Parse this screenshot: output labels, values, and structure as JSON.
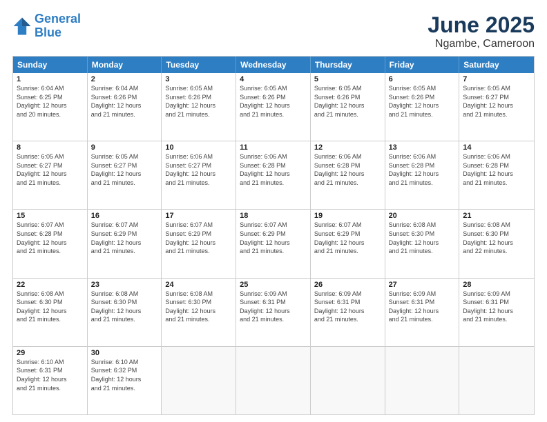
{
  "logo": {
    "line1": "General",
    "line2": "Blue"
  },
  "title": "June 2025",
  "subtitle": "Ngambe, Cameroon",
  "header_days": [
    "Sunday",
    "Monday",
    "Tuesday",
    "Wednesday",
    "Thursday",
    "Friday",
    "Saturday"
  ],
  "weeks": [
    [
      {
        "day": "1",
        "info": "Sunrise: 6:04 AM\nSunset: 6:25 PM\nDaylight: 12 hours\nand 20 minutes."
      },
      {
        "day": "2",
        "info": "Sunrise: 6:04 AM\nSunset: 6:26 PM\nDaylight: 12 hours\nand 21 minutes."
      },
      {
        "day": "3",
        "info": "Sunrise: 6:05 AM\nSunset: 6:26 PM\nDaylight: 12 hours\nand 21 minutes."
      },
      {
        "day": "4",
        "info": "Sunrise: 6:05 AM\nSunset: 6:26 PM\nDaylight: 12 hours\nand 21 minutes."
      },
      {
        "day": "5",
        "info": "Sunrise: 6:05 AM\nSunset: 6:26 PM\nDaylight: 12 hours\nand 21 minutes."
      },
      {
        "day": "6",
        "info": "Sunrise: 6:05 AM\nSunset: 6:26 PM\nDaylight: 12 hours\nand 21 minutes."
      },
      {
        "day": "7",
        "info": "Sunrise: 6:05 AM\nSunset: 6:27 PM\nDaylight: 12 hours\nand 21 minutes."
      }
    ],
    [
      {
        "day": "8",
        "info": "Sunrise: 6:05 AM\nSunset: 6:27 PM\nDaylight: 12 hours\nand 21 minutes."
      },
      {
        "day": "9",
        "info": "Sunrise: 6:05 AM\nSunset: 6:27 PM\nDaylight: 12 hours\nand 21 minutes."
      },
      {
        "day": "10",
        "info": "Sunrise: 6:06 AM\nSunset: 6:27 PM\nDaylight: 12 hours\nand 21 minutes."
      },
      {
        "day": "11",
        "info": "Sunrise: 6:06 AM\nSunset: 6:28 PM\nDaylight: 12 hours\nand 21 minutes."
      },
      {
        "day": "12",
        "info": "Sunrise: 6:06 AM\nSunset: 6:28 PM\nDaylight: 12 hours\nand 21 minutes."
      },
      {
        "day": "13",
        "info": "Sunrise: 6:06 AM\nSunset: 6:28 PM\nDaylight: 12 hours\nand 21 minutes."
      },
      {
        "day": "14",
        "info": "Sunrise: 6:06 AM\nSunset: 6:28 PM\nDaylight: 12 hours\nand 21 minutes."
      }
    ],
    [
      {
        "day": "15",
        "info": "Sunrise: 6:07 AM\nSunset: 6:28 PM\nDaylight: 12 hours\nand 21 minutes."
      },
      {
        "day": "16",
        "info": "Sunrise: 6:07 AM\nSunset: 6:29 PM\nDaylight: 12 hours\nand 21 minutes."
      },
      {
        "day": "17",
        "info": "Sunrise: 6:07 AM\nSunset: 6:29 PM\nDaylight: 12 hours\nand 21 minutes."
      },
      {
        "day": "18",
        "info": "Sunrise: 6:07 AM\nSunset: 6:29 PM\nDaylight: 12 hours\nand 21 minutes."
      },
      {
        "day": "19",
        "info": "Sunrise: 6:07 AM\nSunset: 6:29 PM\nDaylight: 12 hours\nand 21 minutes."
      },
      {
        "day": "20",
        "info": "Sunrise: 6:08 AM\nSunset: 6:30 PM\nDaylight: 12 hours\nand 21 minutes."
      },
      {
        "day": "21",
        "info": "Sunrise: 6:08 AM\nSunset: 6:30 PM\nDaylight: 12 hours\nand 22 minutes."
      }
    ],
    [
      {
        "day": "22",
        "info": "Sunrise: 6:08 AM\nSunset: 6:30 PM\nDaylight: 12 hours\nand 21 minutes."
      },
      {
        "day": "23",
        "info": "Sunrise: 6:08 AM\nSunset: 6:30 PM\nDaylight: 12 hours\nand 21 minutes."
      },
      {
        "day": "24",
        "info": "Sunrise: 6:08 AM\nSunset: 6:30 PM\nDaylight: 12 hours\nand 21 minutes."
      },
      {
        "day": "25",
        "info": "Sunrise: 6:09 AM\nSunset: 6:31 PM\nDaylight: 12 hours\nand 21 minutes."
      },
      {
        "day": "26",
        "info": "Sunrise: 6:09 AM\nSunset: 6:31 PM\nDaylight: 12 hours\nand 21 minutes."
      },
      {
        "day": "27",
        "info": "Sunrise: 6:09 AM\nSunset: 6:31 PM\nDaylight: 12 hours\nand 21 minutes."
      },
      {
        "day": "28",
        "info": "Sunrise: 6:09 AM\nSunset: 6:31 PM\nDaylight: 12 hours\nand 21 minutes."
      }
    ],
    [
      {
        "day": "29",
        "info": "Sunrise: 6:10 AM\nSunset: 6:31 PM\nDaylight: 12 hours\nand 21 minutes."
      },
      {
        "day": "30",
        "info": "Sunrise: 6:10 AM\nSunset: 6:32 PM\nDaylight: 12 hours\nand 21 minutes."
      },
      {
        "day": "",
        "info": ""
      },
      {
        "day": "",
        "info": ""
      },
      {
        "day": "",
        "info": ""
      },
      {
        "day": "",
        "info": ""
      },
      {
        "day": "",
        "info": ""
      }
    ]
  ]
}
